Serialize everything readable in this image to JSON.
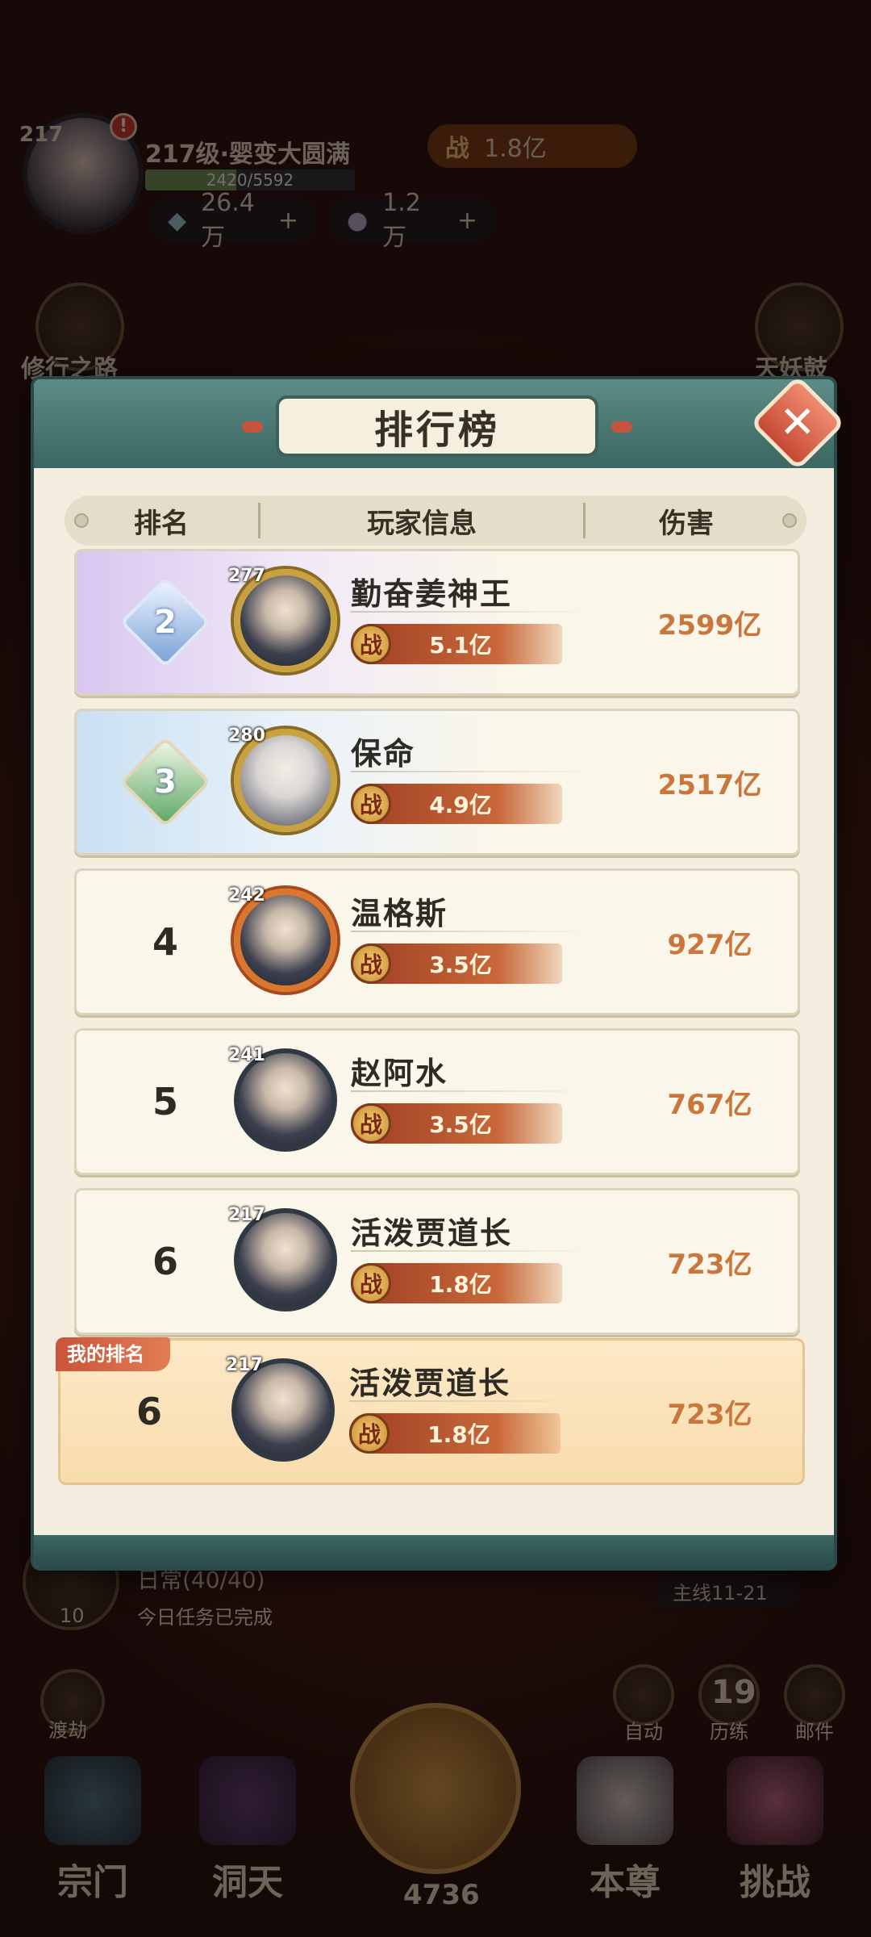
{
  "hud": {
    "player_level_badge": "217",
    "player_title": "217级·婴变大圆满",
    "exp_progress": "2420/5592",
    "exp_fraction": 0.433,
    "combat_label": "战",
    "combat_power": "1.8亿",
    "currency_spirit": "26.4万",
    "currency_jade": "1.2万",
    "plus": "+",
    "left_shortcut": "修行之路",
    "right_shortcut": "天妖鼓",
    "task_count": "10",
    "task_title": "日常(40/40)",
    "task_status": "今日任务已完成",
    "mainline": "主线11-21",
    "left_skill": "渡劫",
    "quick_buttons": [
      {
        "label": "自动",
        "icon": "auto-icon"
      },
      {
        "label": "历练",
        "icon": "train-icon",
        "count": "19"
      },
      {
        "label": "邮件",
        "icon": "mail-icon"
      }
    ],
    "nav": [
      {
        "label": "宗门"
      },
      {
        "label": "洞天"
      },
      {
        "label": "本尊"
      },
      {
        "label": "挑战"
      }
    ],
    "center_count": "4736",
    "notice": "!"
  },
  "leaderboard": {
    "title": "排行榜",
    "close_icon": "close-icon",
    "close_symbol": "✕",
    "columns": {
      "rank": "排名",
      "player": "玩家信息",
      "damage": "伤害"
    },
    "power_label": "战",
    "rows": [
      {
        "rank": "2",
        "level": "277",
        "name": "勤奋姜神王",
        "power": "5.1亿",
        "damage": "2599亿"
      },
      {
        "rank": "3",
        "level": "280",
        "name": "保命",
        "power": "4.9亿",
        "damage": "2517亿"
      },
      {
        "rank": "4",
        "level": "242",
        "name": "温格斯",
        "power": "3.5亿",
        "damage": "927亿"
      },
      {
        "rank": "5",
        "level": "241",
        "name": "赵阿水",
        "power": "3.5亿",
        "damage": "767亿"
      },
      {
        "rank": "6",
        "level": "217",
        "name": "活泼贾道长",
        "power": "1.8亿",
        "damage": "723亿"
      }
    ],
    "mine": {
      "tag": "我的排名",
      "rank": "6",
      "level": "217",
      "name": "活泼贾道长",
      "power": "1.8亿",
      "damage": "723亿"
    }
  }
}
